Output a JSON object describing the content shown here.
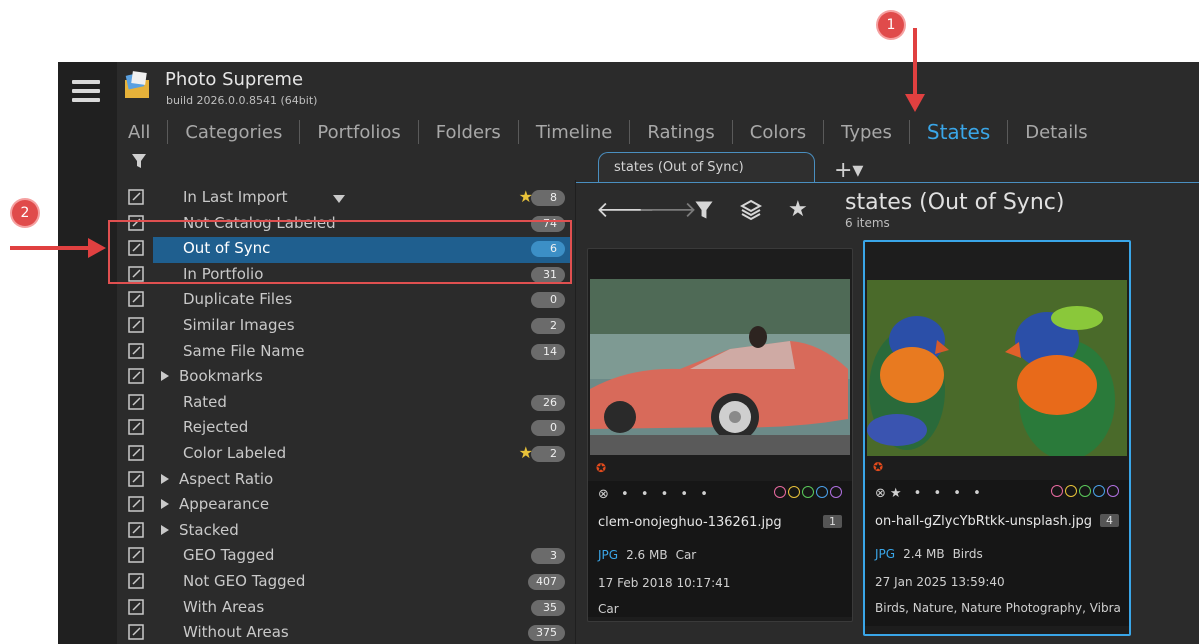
{
  "app": {
    "title": "Photo Supreme",
    "build": "build 2026.0.0.8541 (64bit)"
  },
  "tabs": [
    "All",
    "Categories",
    "Portfolios",
    "Folders",
    "Timeline",
    "Ratings",
    "Colors",
    "Types",
    "States",
    "Details"
  ],
  "active_tab": "States",
  "tree": [
    {
      "label": "In Last Import",
      "count": "8",
      "star": true,
      "dropdown": true
    },
    {
      "label": "Not Catalog Labeled",
      "count": "74"
    },
    {
      "label": "Out of Sync",
      "count": "6",
      "selected": true
    },
    {
      "label": "In Portfolio",
      "count": "31"
    },
    {
      "label": "Duplicate Files",
      "count": "0"
    },
    {
      "label": "Similar Images",
      "count": "2"
    },
    {
      "label": "Same File Name",
      "count": "14"
    },
    {
      "label": "Bookmarks",
      "expandable": true
    },
    {
      "label": "Rated",
      "count": "26"
    },
    {
      "label": "Rejected",
      "count": "0"
    },
    {
      "label": "Color Labeled",
      "count": "2",
      "star": true
    },
    {
      "label": "Aspect Ratio",
      "expandable": true
    },
    {
      "label": "Appearance",
      "expandable": true
    },
    {
      "label": "Stacked",
      "expandable": true
    },
    {
      "label": "GEO Tagged",
      "count": "3"
    },
    {
      "label": "Not GEO Tagged",
      "count": "407"
    },
    {
      "label": "With Areas",
      "count": "35"
    },
    {
      "label": "Without Areas",
      "count": "375"
    }
  ],
  "browser_tab": {
    "label": "states (Out of Sync)",
    "add": "+▾"
  },
  "view": {
    "title": "states (Out of Sync)",
    "subtitle": "6 items"
  },
  "cards": [
    {
      "filename": "clem-onojeghuo-136261.jpg",
      "badge": "1",
      "type": "JPG",
      "size": "2.6 MB",
      "category": "Car",
      "date": "17 Feb 2018 10:17:41",
      "tags": "Car",
      "rating": "⊗ • • • • •",
      "selected": false
    },
    {
      "filename": "on-hall-gZlycYbRtkk-unsplash.jpg",
      "badge": "4",
      "type": "JPG",
      "size": "2.4 MB",
      "category": "Birds",
      "date": "27 Jan 2025 13:59:40",
      "tags": "Birds, Nature, Nature Photography, Vibra",
      "rating": "⊗★ • • • •",
      "selected": true
    }
  ],
  "color_labels": [
    "#e86aa0",
    "#e8c23a",
    "#5ac85a",
    "#4aa0e8",
    "#b070e0"
  ],
  "annotations": {
    "marker1": "1",
    "marker2": "2"
  }
}
